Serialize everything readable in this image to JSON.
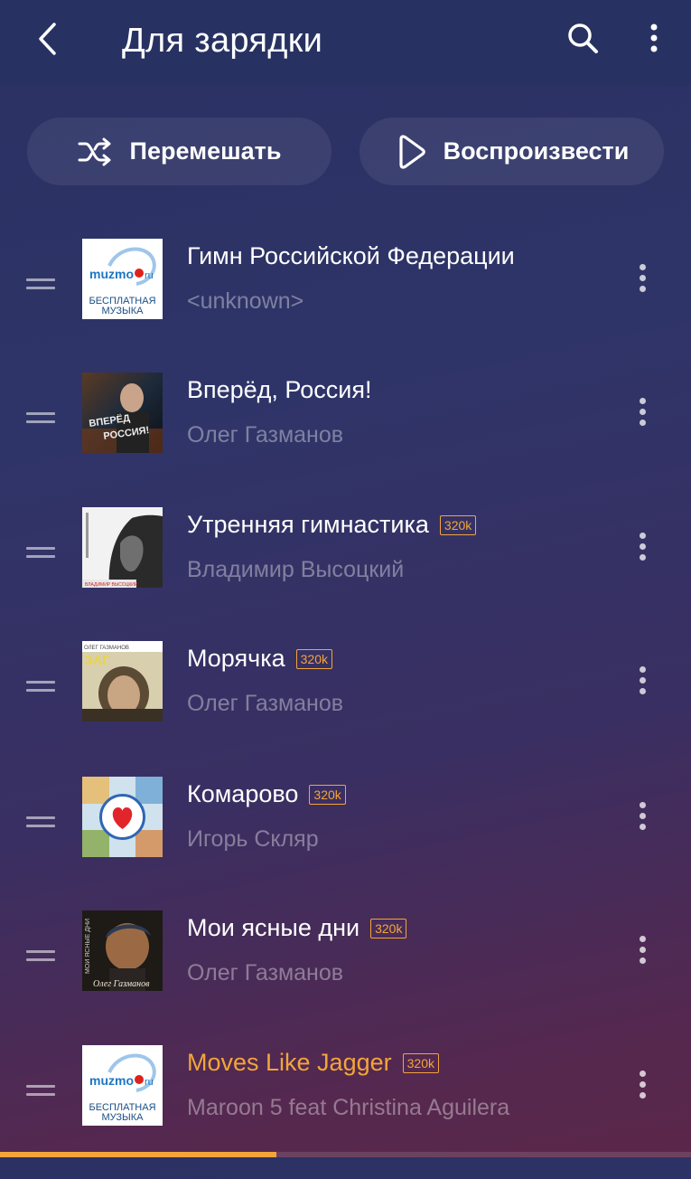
{
  "header": {
    "title": "Для зарядки"
  },
  "actions": {
    "shuffle_label": "Перемешать",
    "play_label": "Воспроизвести"
  },
  "tracks": [
    {
      "title": "Гимн Российской Федерации",
      "artist": "<unknown>",
      "badge": "",
      "cover": "muzmo"
    },
    {
      "title": "Вперёд, Россия!",
      "artist": "Олег Газманов",
      "badge": "",
      "cover": "vpered"
    },
    {
      "title": "Утренняя гимнастика",
      "artist": "Владимир Высоцкий",
      "badge": "320k",
      "cover": "vysotsky"
    },
    {
      "title": "Морячка",
      "artist": "Олег Газманов",
      "badge": "320k",
      "cover": "moryachka"
    },
    {
      "title": "Комарово",
      "artist": "Игорь Скляр",
      "badge": "320k",
      "cover": "komarovo"
    },
    {
      "title": "Мои ясные дни",
      "artist": "Олег Газманов",
      "badge": "320k",
      "cover": "yasnye"
    },
    {
      "title": "Moves Like Jagger",
      "artist": "Maroon 5 feat Christina Aguilera",
      "badge": "320k",
      "cover": "muzmo",
      "active": true
    }
  ],
  "covers": {
    "muzmo": {
      "brand": "muzmo",
      "brand_suffix": "ru",
      "line1": "БЕСПЛАТНАЯ",
      "line2": "МУЗЫКА"
    }
  },
  "progress": {
    "fraction": 0.4
  },
  "colors": {
    "accent": "#f3a53a",
    "header_bg": "#283262"
  }
}
